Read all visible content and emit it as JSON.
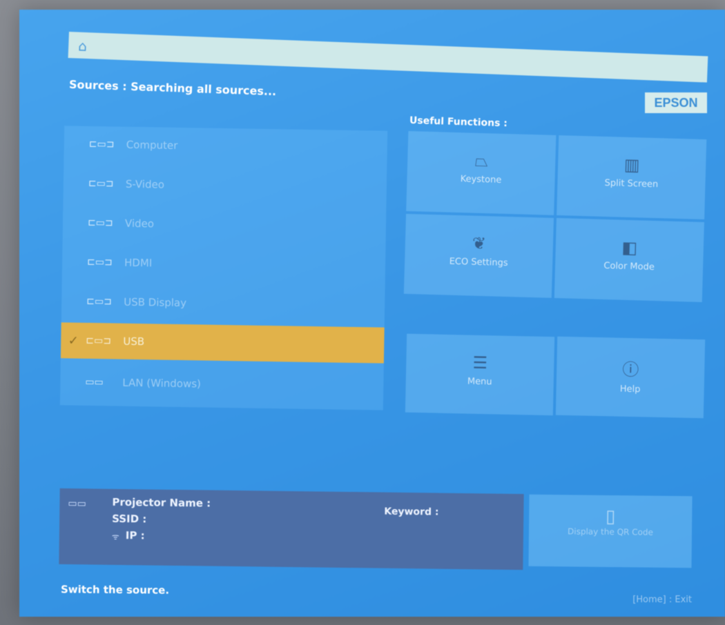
{
  "brand": {
    "logo_text": "EPSON"
  },
  "topbar": {
    "home_icon": "home-icon"
  },
  "sources": {
    "title": "Sources :  Searching all sources...",
    "items": [
      {
        "label": "Computer",
        "icon": "computer-connector-icon",
        "selected": false
      },
      {
        "label": "S-Video",
        "icon": "svideo-connector-icon",
        "selected": false
      },
      {
        "label": "Video",
        "icon": "video-connector-icon",
        "selected": false
      },
      {
        "label": "HDMI",
        "icon": "hdmi-connector-icon",
        "selected": false
      },
      {
        "label": "USB Display",
        "icon": "usb-display-connector-icon",
        "selected": false
      },
      {
        "label": "USB",
        "icon": "usb-connector-icon",
        "selected": true
      },
      {
        "label": "LAN (Windows)",
        "icon": "lan-connector-icon",
        "selected": false
      }
    ]
  },
  "useful": {
    "title": "Useful Functions :",
    "tiles": [
      {
        "label": "Keystone",
        "icon": "keystone-icon"
      },
      {
        "label": "Split Screen",
        "icon": "split-screen-icon"
      },
      {
        "label": "ECO Settings",
        "icon": "leaf-icon"
      },
      {
        "label": "Color Mode",
        "icon": "color-mode-icon"
      },
      {
        "label": "Menu",
        "icon": "menu-icon"
      },
      {
        "label": "Help",
        "icon": "help-icon"
      }
    ]
  },
  "network": {
    "projector_name_label": "Projector Name :",
    "ssid_label": "SSID :",
    "ip_label": "IP :",
    "keyword_label": "Keyword :",
    "qr_label": "Display the QR Code"
  },
  "footer": {
    "hint": "Switch the source.",
    "exit": "[Home] : Exit"
  },
  "colors": {
    "screen_blue": "#3a97e6",
    "selected_row": "#e1b24a",
    "bottom_panel": "#4c6ea6"
  }
}
